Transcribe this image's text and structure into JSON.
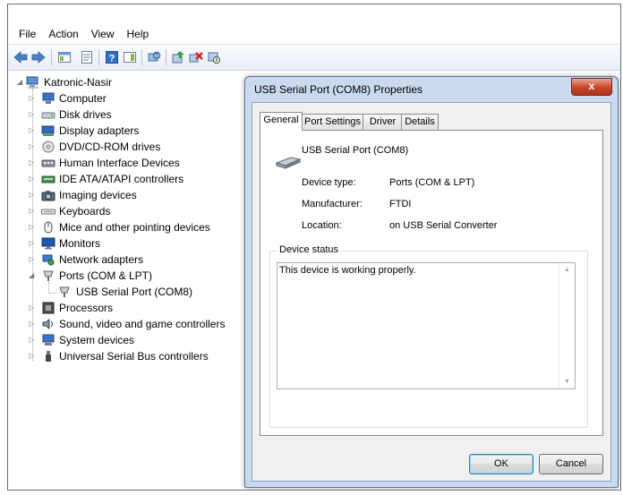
{
  "menu": [
    "File",
    "Action",
    "View",
    "Help"
  ],
  "toolbar_icons": [
    "back-arrow-icon",
    "forward-arrow-icon",
    "show-hide-console-tree-icon",
    "properties-icon",
    "help-icon",
    "show-action-pane-icon",
    "scan-hardware-icon",
    "update-driver-icon",
    "uninstall-icon",
    "disable-device-icon"
  ],
  "tree": {
    "root": "Katronic-Nasir",
    "items": [
      {
        "label": "Computer"
      },
      {
        "label": "Disk drives"
      },
      {
        "label": "Display adapters"
      },
      {
        "label": "DVD/CD-ROM drives"
      },
      {
        "label": "Human Interface Devices"
      },
      {
        "label": "IDE ATA/ATAPI controllers"
      },
      {
        "label": "Imaging devices"
      },
      {
        "label": "Keyboards"
      },
      {
        "label": "Mice and other pointing devices"
      },
      {
        "label": "Monitors"
      },
      {
        "label": "Network adapters"
      },
      {
        "label": "Ports (COM & LPT)"
      },
      {
        "label": "USB Serial Port (COM8)"
      },
      {
        "label": "Processors"
      },
      {
        "label": "Sound, video and game controllers"
      },
      {
        "label": "System devices"
      },
      {
        "label": "Universal Serial Bus controllers"
      }
    ]
  },
  "dialog": {
    "title": "USB Serial Port (COM8) Properties",
    "close_label": "x",
    "tabs": [
      "General",
      "Port Settings",
      "Driver",
      "Details"
    ],
    "device_name": "USB Serial Port (COM8)",
    "device_type_label": "Device type:",
    "device_type_value": "Ports (COM & LPT)",
    "manufacturer_label": "Manufacturer:",
    "manufacturer_value": "FTDI",
    "location_label": "Location:",
    "location_value": "on USB Serial Converter",
    "status_group_label": "Device status",
    "status_text": "This device is working properly.",
    "ok_label": "OK",
    "cancel_label": "Cancel"
  }
}
